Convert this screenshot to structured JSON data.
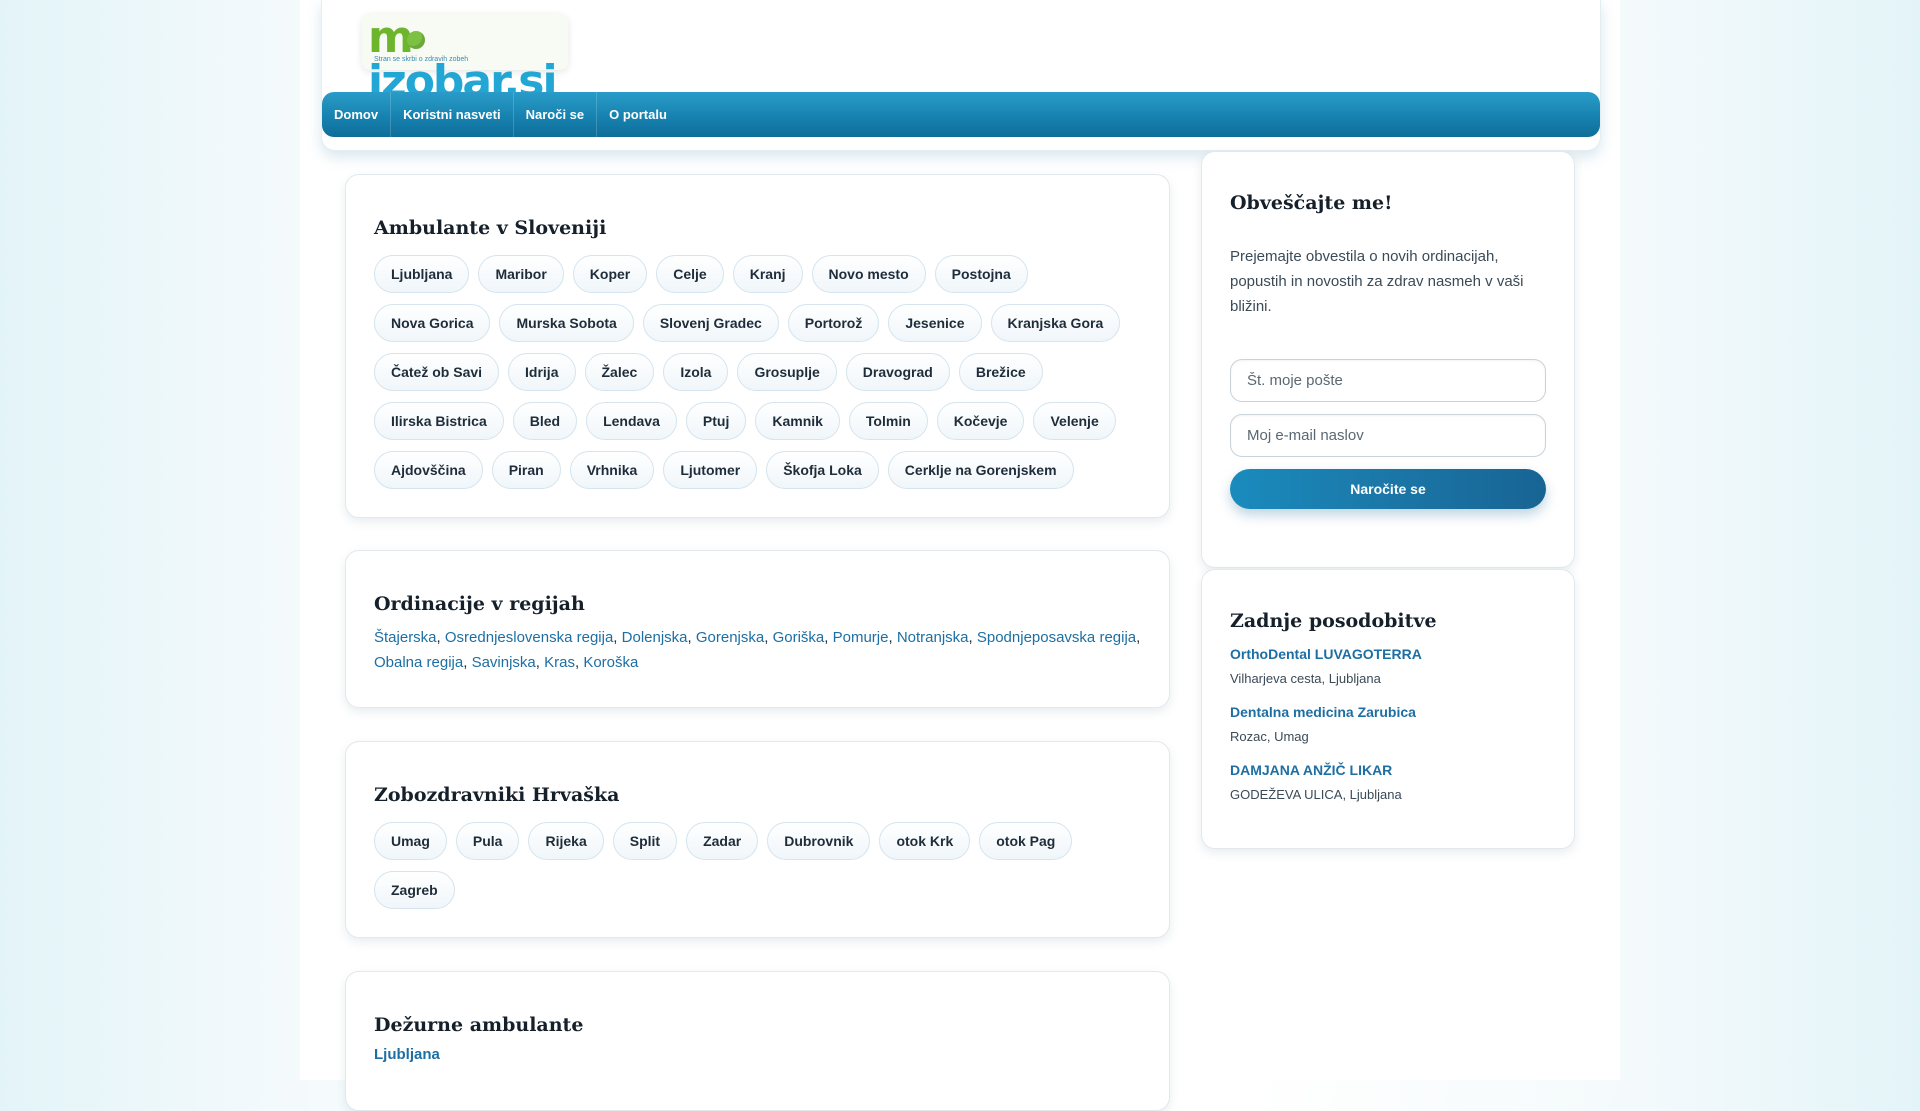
{
  "logo": {
    "text_prefix": "m",
    "text_rest": "jzobar.si",
    "tagline": "Stran se skrbi o zdravih zobeh",
    "colors": {
      "green": "#6cb52d",
      "blue": "#22a6d4"
    }
  },
  "nav": {
    "items": [
      "Domov",
      "Koristni nasveti",
      "Naroči se",
      "O portalu"
    ]
  },
  "ambulante": {
    "title": "Ambulante v Sloveniji",
    "cities": [
      "Ljubljana",
      "Maribor",
      "Koper",
      "Celje",
      "Kranj",
      "Novo mesto",
      "Postojna",
      "Nova Gorica",
      "Murska Sobota",
      "Slovenj Gradec",
      "Portorož",
      "Jesenice",
      "Kranjska Gora",
      "Čatež ob Savi",
      "Idrija",
      "Žalec",
      "Izola",
      "Grosuplje",
      "Dravograd",
      "Brežice",
      "Ilirska Bistrica",
      "Bled",
      "Lendava",
      "Ptuj",
      "Kamnik",
      "Tolmin",
      "Kočevje",
      "Velenje",
      "Ajdovščina",
      "Piran",
      "Vrhnika",
      "Ljutomer",
      "Škofja Loka",
      "Cerklje na Gorenjskem"
    ]
  },
  "regije": {
    "title": "Ordinacije v regijah",
    "items": [
      "Štajerska",
      "Osrednjeslovenska regija",
      "Dolenjska",
      "Gorenjska",
      "Goriška",
      "Pomurje",
      "Notranjska",
      "Spodnjeposavska regija",
      "Obalna regija",
      "Savinjska",
      "Kras",
      "Koroška"
    ]
  },
  "hrvaska": {
    "title": "Zobozdravniki Hrvaška",
    "cities": [
      "Umag",
      "Pula",
      "Rijeka",
      "Split",
      "Zadar",
      "Dubrovnik",
      "otok Krk",
      "otok Pag",
      "Zagreb"
    ]
  },
  "dezurne": {
    "title": "Dežurne ambulante",
    "link": "Ljubljana"
  },
  "subscribe": {
    "title": "Obveščajte me!",
    "text": "Prejemajte obvestila o novih ordinacijah, popustih in novostih za zdrav nasmeh v vaši bližini.",
    "postal_placeholder": "Št. moje pošte",
    "email_placeholder": "Moj e-mail naslov",
    "button": "Naročite se"
  },
  "updates": {
    "title": "Zadnje posodobitve",
    "items": [
      {
        "name": "OrthoDental LUVAGOTERRA",
        "address": "Vilharjeva cesta, Ljubljana"
      },
      {
        "name": "Dentalna medicina Zarubica",
        "address": "Rozac, Umag"
      },
      {
        "name": "DAMJANA ANŽIČ LIKAR",
        "address": "GODEŽEVA ULICA, Ljubljana"
      }
    ]
  }
}
